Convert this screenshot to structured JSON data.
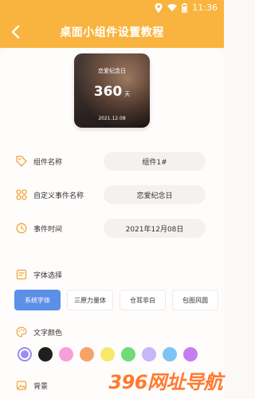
{
  "status": {
    "time": "11:36"
  },
  "header": {
    "title": "桌面小组件设置教程"
  },
  "preview": {
    "event": "恋爱纪念日",
    "days": "360",
    "unit": "天",
    "date": "2021.12.08"
  },
  "rows": [
    {
      "label": "组件名称",
      "value": "组件1#",
      "icon": "tag-icon"
    },
    {
      "label": "自定义事件名称",
      "value": "恋爱纪念日",
      "icon": "grid-icon"
    },
    {
      "label": "事件时间",
      "value": "2021年12月08日",
      "icon": "clock-icon"
    }
  ],
  "font_section": {
    "label": "字体选择"
  },
  "fonts": [
    {
      "label": "系统字体",
      "active": true
    },
    {
      "label": "三原力量体",
      "active": false
    },
    {
      "label": "仓耳非白",
      "active": false
    },
    {
      "label": "包图风圆",
      "active": false
    }
  ],
  "color_section": {
    "label": "文字颜色"
  },
  "colors": [
    "#9b8cf0",
    "#1f1f1f",
    "#f6a0d9",
    "#f6a36a",
    "#f7e86a",
    "#6fdc78",
    "#c4b8f6",
    "#7cc4f4",
    "#c77cf0"
  ],
  "background_section": {
    "label": "背景"
  },
  "watermark": "396网址导航"
}
